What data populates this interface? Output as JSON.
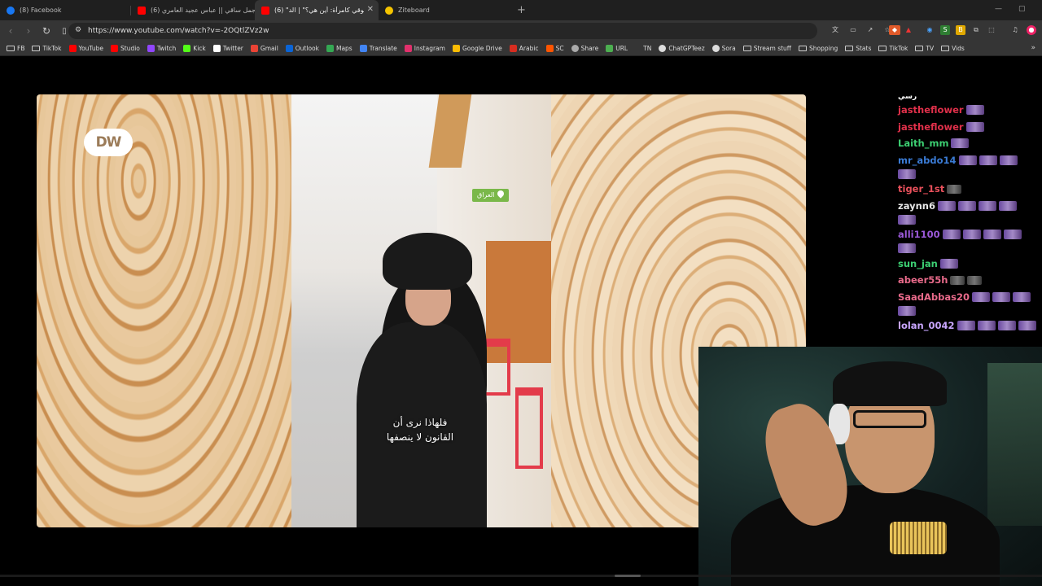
{
  "tabs": [
    {
      "label": "(8) Facebook",
      "color": "#1877f2",
      "active": false
    },
    {
      "label": "(6) اجمل ساقي || عباس عجيد العامري -i",
      "color": "#ff0000",
      "active": false
    },
    {
      "label": "(6) \"حقوقي كامرأة: أين هي؟\" | الد...",
      "color": "#ff0000",
      "active": true
    },
    {
      "label": "Ziteboard",
      "color": "#f5c400",
      "active": false
    }
  ],
  "url": "https://www.youtube.com/watch?v=-2OQtlZVz2w",
  "bookmarks": [
    {
      "label": "FB",
      "icon": "folder-icon"
    },
    {
      "label": "TikTok",
      "icon": "folder-icon"
    },
    {
      "label": "YouTube",
      "icon": "youtube-icon",
      "color": "#ff0000"
    },
    {
      "label": "Studio",
      "icon": "studio-icon",
      "color": "#ff0000"
    },
    {
      "label": "Twitch",
      "icon": "twitch-icon",
      "color": "#9146ff"
    },
    {
      "label": "Kick",
      "icon": "kick-icon",
      "color": "#53fc18"
    },
    {
      "label": "Twitter",
      "icon": "x-icon",
      "color": "#ffffff"
    },
    {
      "label": "Gmail",
      "icon": "gmail-icon",
      "color": "#ea4335"
    },
    {
      "label": "Outlook",
      "icon": "outlook-icon",
      "color": "#0a64d6"
    },
    {
      "label": "Maps",
      "icon": "maps-icon",
      "color": "#34a853"
    },
    {
      "label": "Translate",
      "icon": "translate-icon",
      "color": "#4285f4"
    },
    {
      "label": "Instagram",
      "icon": "instagram-icon",
      "color": "#e1306c"
    },
    {
      "label": "Google Drive",
      "icon": "drive-icon",
      "color": "#fbbc04"
    },
    {
      "label": "Arabic",
      "icon": "arabic-icon",
      "color": "#d62d20"
    },
    {
      "label": "SC",
      "icon": "soundcloud-icon",
      "color": "#ff5500"
    },
    {
      "label": "Share",
      "icon": "cloud-icon",
      "color": "#aaaaaa"
    },
    {
      "label": "URL",
      "icon": "url-icon",
      "color": "#4caf50"
    },
    {
      "label": "TN",
      "icon": "none"
    },
    {
      "label": "ChatGPTeez",
      "icon": "chatgpt-icon",
      "color": "#dddddd"
    },
    {
      "label": "Sora",
      "icon": "sora-icon",
      "color": "#dddddd"
    },
    {
      "label": "Stream stuff",
      "icon": "folder-icon"
    },
    {
      "label": "Shopping",
      "icon": "folder-icon"
    },
    {
      "label": "Stats",
      "icon": "folder-icon"
    },
    {
      "label": "TikTok",
      "icon": "folder-icon"
    },
    {
      "label": "TV",
      "icon": "folder-icon"
    },
    {
      "label": "Vids",
      "icon": "folder-icon"
    }
  ],
  "video": {
    "logo": "DW",
    "location_tag": "العراق",
    "subtitle_line1": "فلهاذا نرى أن",
    "subtitle_line2": "القانون لا ينصفها"
  },
  "chat": [
    {
      "user": "رسي",
      "color": "#ffffff",
      "emotes": 0
    },
    {
      "user": "jastheflower",
      "color": "#e0304a",
      "emotes": 1
    },
    {
      "user": "jastheflower",
      "color": "#e0304a",
      "emotes": 1
    },
    {
      "user": "Laith_mm",
      "color": "#3ccf72",
      "emotes": 1
    },
    {
      "user": "mr_abdo14",
      "color": "#3a7bd5",
      "emotes": 5
    },
    {
      "user": "tiger_1st",
      "color": "#e8505b",
      "emotes": 1
    },
    {
      "user": "zaynn6",
      "color": "#e6e6e6",
      "emotes": 6
    },
    {
      "user": "alli1100",
      "color": "#9b59d9",
      "emotes": 6
    },
    {
      "user": "sun_jan",
      "color": "#3ccf72",
      "emotes": 1
    },
    {
      "user": "abeer55h",
      "color": "#e86a8a",
      "emotes": 2
    },
    {
      "user": "SaadAbbas20",
      "color": "#e86a8a",
      "emotes": 5
    },
    {
      "user": "lolan_0042",
      "color": "#c9a6ff",
      "emotes": 5
    }
  ]
}
